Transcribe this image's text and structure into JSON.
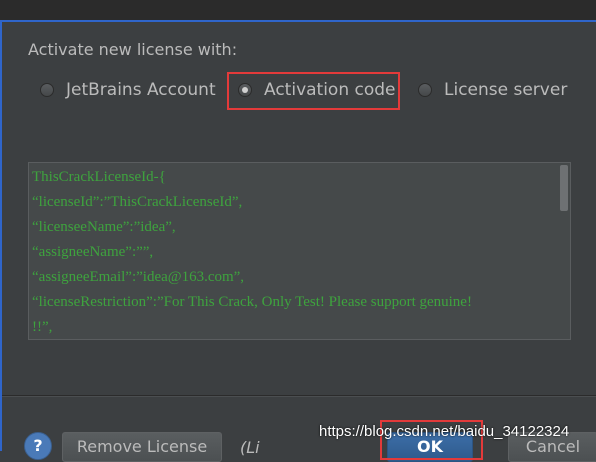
{
  "license_dialog": {
    "activate_label": "Activate new license with:",
    "options": [
      {
        "label": "JetBrains Account",
        "selected": false
      },
      {
        "label": "Activation code",
        "selected": true
      },
      {
        "label": "License server",
        "selected": false
      }
    ],
    "activation_code_lines": [
      "ThisCrackLicenseId-{",
      "“licenseId”:”ThisCrackLicenseId”,",
      "“licenseeName”:”idea”,",
      "“assigneeName”:””,",
      "“assigneeEmail”:”idea@163.com”,",
      "“licenseRestriction”:”For This Crack, Only Test! Please support genuine!",
      "!!”,"
    ]
  },
  "footer": {
    "help_label": "?",
    "remove_license_label": "Remove License",
    "partial_text": "(Li",
    "ok_label": "OK",
    "cancel_label": "Cancel"
  },
  "watermark": "https://blog.csdn.net/baidu_34122324",
  "colors": {
    "background": "#3c3f41",
    "code_text": "#3ea33e",
    "highlight_box": "#e33a3a",
    "accent": "#2f65ca"
  }
}
